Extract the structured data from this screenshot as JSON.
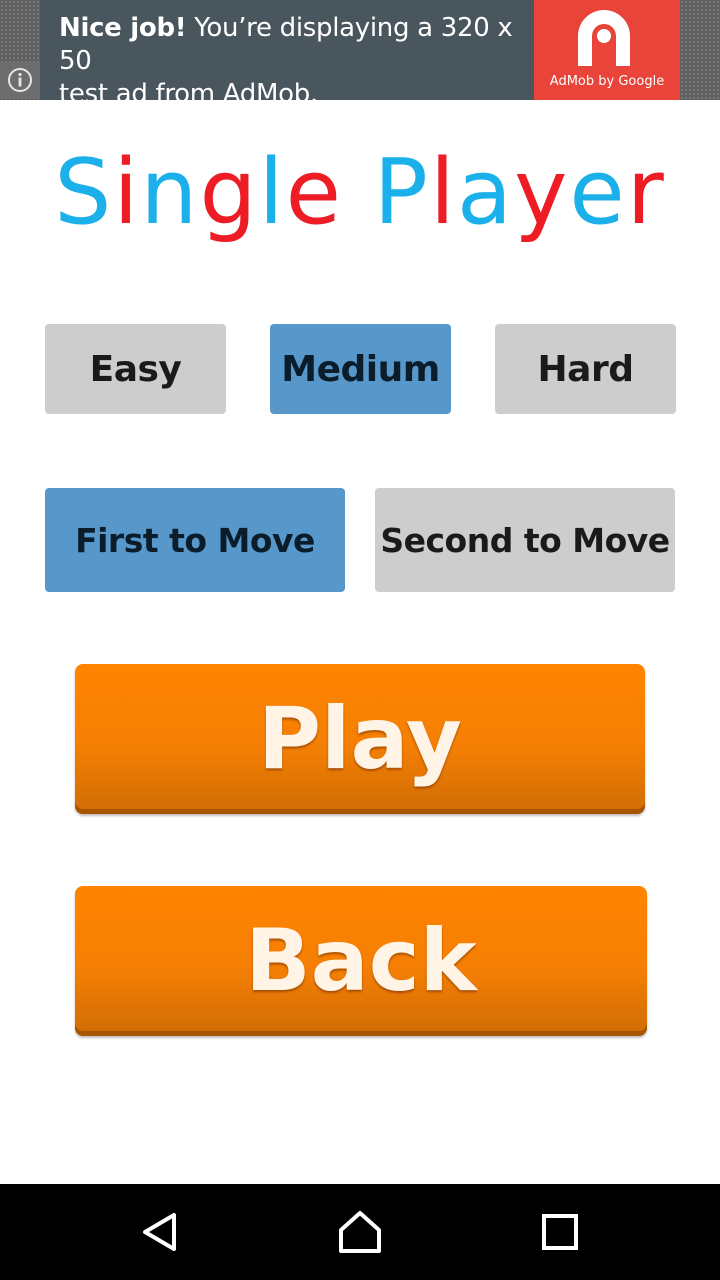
{
  "ad": {
    "headline_bold": "Nice job!",
    "headline_rest": "You’re displaying a 320 x 50",
    "line2": "test ad from AdMob.",
    "brand_caption": "AdMob by Google",
    "info_icon": "info-icon",
    "logo_icon": "admob-logo-icon",
    "colors": {
      "body": "#4a565e",
      "logo_bg": "#e8443a"
    }
  },
  "title": {
    "parts": [
      {
        "text": "S",
        "color": "#1cb0ea"
      },
      {
        "text": "i",
        "color": "#ee1c24"
      },
      {
        "text": "n",
        "color": "#1cb0ea"
      },
      {
        "text": "g",
        "color": "#ee1c24"
      },
      {
        "text": "l",
        "color": "#1cb0ea"
      },
      {
        "text": "e",
        "color": "#ee1c24"
      },
      {
        "text": " ",
        "color": "#1cb0ea"
      },
      {
        "text": "P",
        "color": "#1cb0ea"
      },
      {
        "text": "l",
        "color": "#ee1c24"
      },
      {
        "text": "a",
        "color": "#1cb0ea"
      },
      {
        "text": "y",
        "color": "#ee1c24"
      },
      {
        "text": "e",
        "color": "#1cb0ea"
      },
      {
        "text": "r",
        "color": "#ee1c24"
      }
    ]
  },
  "difficulty": {
    "options": [
      "Easy",
      "Medium",
      "Hard"
    ],
    "selected": "Medium"
  },
  "turn": {
    "options": [
      "First to Move",
      "Second to Move"
    ],
    "selected": "First to Move"
  },
  "actions": {
    "play_label": "Play",
    "back_label": "Back"
  },
  "colors": {
    "selected": "#5797c9",
    "unselected": "#cecdce",
    "action": "#ff8400"
  },
  "navbar": {
    "back_icon": "nav-back-icon",
    "home_icon": "nav-home-icon",
    "recent_icon": "nav-recent-apps-icon"
  }
}
